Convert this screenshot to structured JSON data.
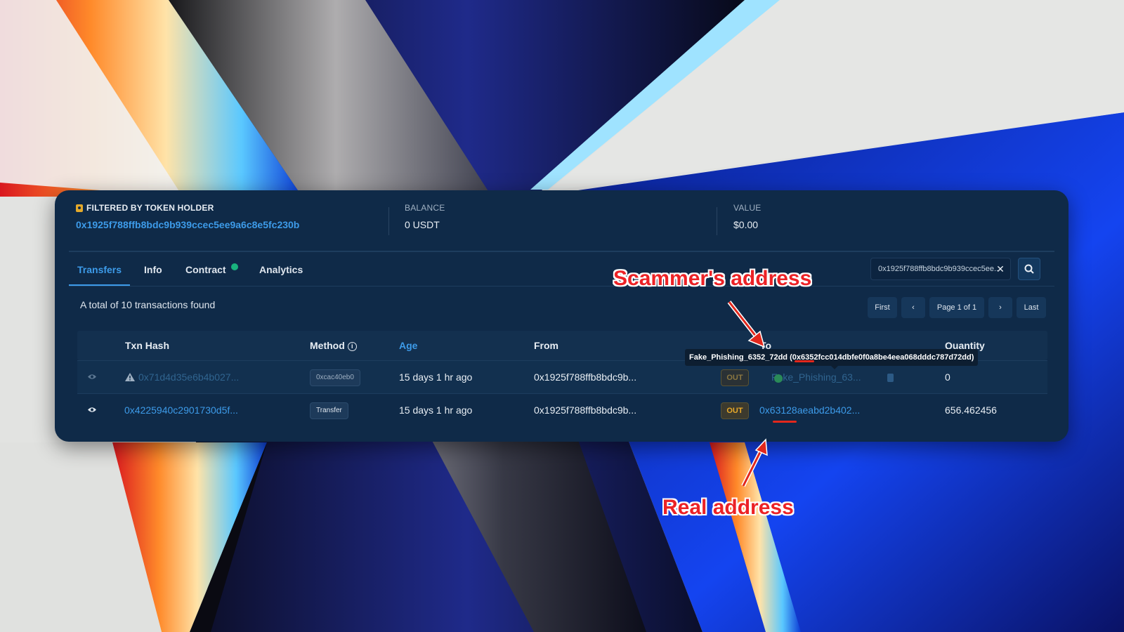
{
  "filter": {
    "holder_label": "FILTERED BY TOKEN HOLDER",
    "holder_address": "0x1925f788ffb8bdc9b939ccec5ee9a6c8e5fc230b",
    "balance_label": "BALANCE",
    "balance_value": "0 USDT",
    "value_label": "VALUE",
    "value_amount": "$0.00"
  },
  "tabs": [
    {
      "label": "Transfers",
      "active": true
    },
    {
      "label": "Info"
    },
    {
      "label": "Contract",
      "verified": true
    },
    {
      "label": "Analytics"
    }
  ],
  "search": {
    "value": "0x1925f788ffb8bdc9b939ccec5ee..."
  },
  "summary": "A total of 10 transactions found",
  "pager": {
    "first": "First",
    "prev": "‹",
    "page": "Page 1 of 1",
    "next": "›",
    "last": "Last"
  },
  "table": {
    "headers": {
      "txn_hash": "Txn Hash",
      "method": "Method",
      "age": "Age",
      "from": "From",
      "to": "To",
      "quantity": "Quantity"
    },
    "rows": [
      {
        "hash": "0x71d4d35e6b4b027...",
        "method": "0xcac40eb0",
        "age": "15 days 1 hr ago",
        "from": "0x1925f788ffb8bdc9b...",
        "direction": "OUT",
        "to": "Fake_Phishing_63...",
        "quantity": "0",
        "flagged": true
      },
      {
        "hash": "0x4225940c2901730d5f...",
        "method": "Transfer",
        "age": "15 days 1 hr ago",
        "from": "0x1925f788ffb8bdc9b...",
        "direction": "OUT",
        "to": "0x63128aeabd2b402...",
        "quantity": "656.462456",
        "flagged": false
      }
    ]
  },
  "tooltip": "Fake_Phishing_6352_72dd (0x6352fcc014dbfe0f0a8be4eea068dddc787d72dd)",
  "annotations": {
    "scammer": "Scammer's address",
    "real": "Real address"
  },
  "colors": {
    "panel": "#0f2a48",
    "accent": "#3d9be9",
    "out_badge": "#e7a92a",
    "annotation": "#ec2226"
  }
}
